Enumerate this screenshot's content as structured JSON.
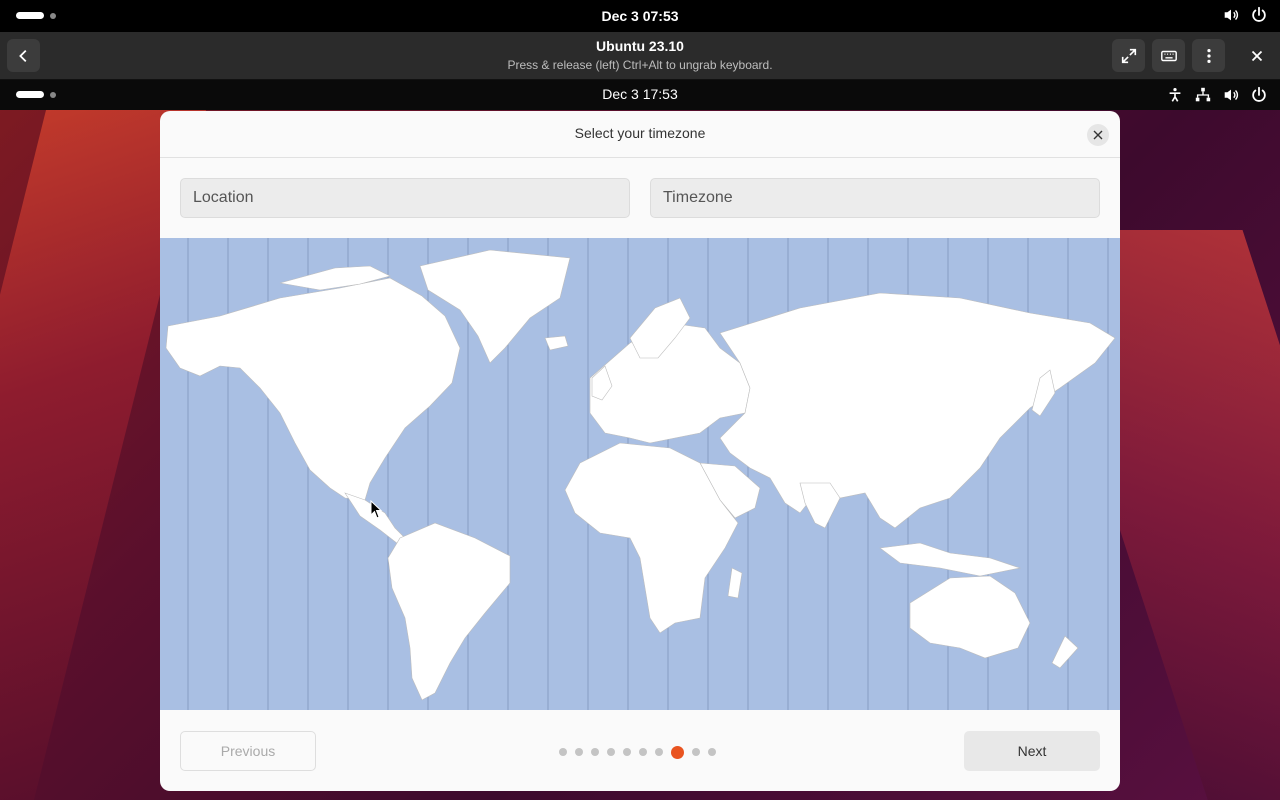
{
  "host": {
    "clock": "Dec 3  07:53",
    "window_title": "Ubuntu 23.10",
    "window_subtitle": "Press & release (left) Ctrl+Alt to ungrab keyboard."
  },
  "guest": {
    "clock": "Dec 3  17:53"
  },
  "dialog": {
    "title": "Select your timezone",
    "location_placeholder": "Location",
    "timezone_placeholder": "Timezone",
    "previous_label": "Previous",
    "next_label": "Next",
    "page_count": 10,
    "current_page": 8
  },
  "colors": {
    "accent": "#e95420",
    "map_ocean": "#a9bfe3",
    "land": "#ffffff"
  },
  "icons": [
    "back-icon",
    "fullscreen-icon",
    "keyboard-icon",
    "menu-icon",
    "close-icon",
    "volume-icon",
    "power-icon",
    "accessibility-icon",
    "network-icon"
  ]
}
